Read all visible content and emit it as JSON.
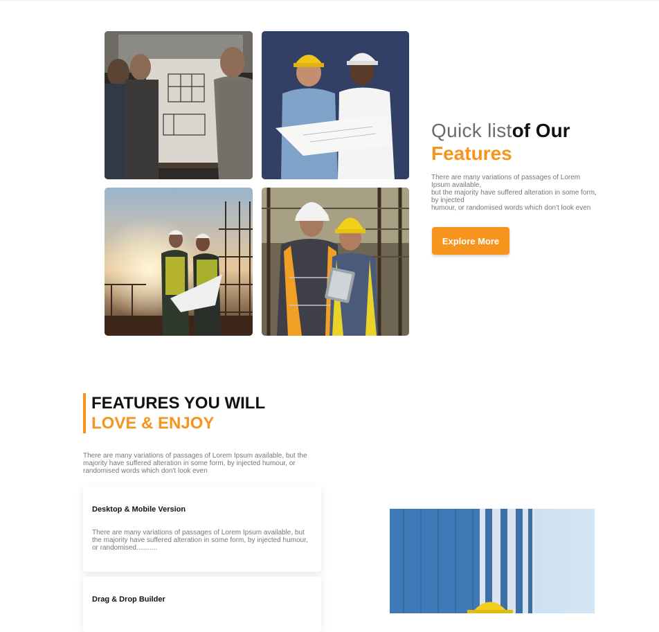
{
  "quick_list": {
    "title_light": "Quick list",
    "title_dark": "of Our",
    "title_accent": "Features",
    "description_lines": [
      "There are many variations of passages of Lorem Ipsum available,",
      "but the majority have suffered alteration in some form, by injected",
      "humour, or randomised words which don't look even"
    ],
    "button_label": "Explore More"
  },
  "features": {
    "heading_line1": "FEATURES YOU WILL",
    "heading_line2": "LOVE & ENJOY",
    "description": "There are many variations of passages of Lorem Ipsum available, but the majority have suffered alteration in some form, by injected humour, or randomised words which don't look even",
    "cards": [
      {
        "title": "Desktop & Mobile Version",
        "text": "There are many variations of passages of Lorem Ipsum available, but the majority have suffered alteration in some form, by injected humour, or randomised..........."
      },
      {
        "title": "Drag & Drop Builder"
      }
    ]
  },
  "colors": {
    "accent": "#f7941d",
    "heading": "#111111",
    "body_text": "#777777"
  },
  "images": [
    "team-blueprint-whiteboard-photo",
    "hardhat-engineers-blueprint-photo",
    "site-sunset-engineers-photo",
    "workers-tablet-vests-photo",
    "glass-building-worker-photo"
  ]
}
